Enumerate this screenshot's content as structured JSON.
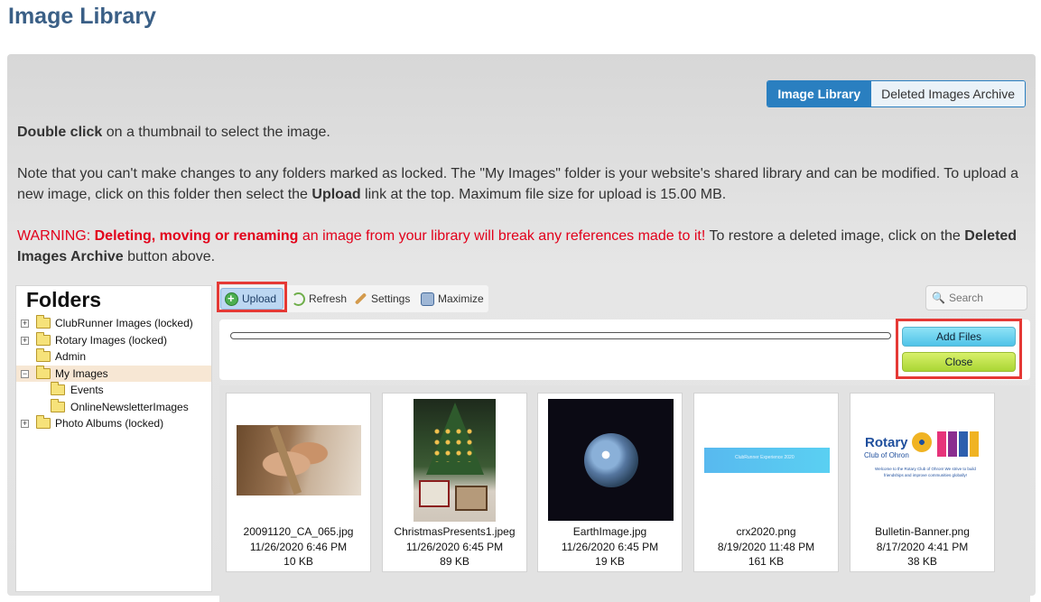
{
  "page": {
    "title": "Image Library"
  },
  "tabs": [
    {
      "label": "Image Library",
      "active": true
    },
    {
      "label": "Deleted Images Archive",
      "active": false
    }
  ],
  "instructions": {
    "line1_bold": "Double click",
    "line1_rest": " on a thumbnail to select the image.",
    "line2_part1": "Note that you can't make changes to any folders marked as locked. The \"My Images\" folder is your website's shared library and can be modified. To upload a new image, click on this folder then select the ",
    "line2_bold": "Upload",
    "line2_part2": " link at the top. Maximum file size for upload is 15.00 MB.",
    "warning_prefix": "WARNING: ",
    "warning_bold": "Deleting, moving or renaming",
    "warning_red_rest": " an image from your library will break any references made to it!",
    "warning_tail": " To restore a deleted image, click on the ",
    "warning_tail_bold": "Deleted Images Archive",
    "warning_tail_end": " button above."
  },
  "folders": {
    "title": "Folders",
    "items": [
      {
        "label": "ClubRunner Images (locked)",
        "expander": "+"
      },
      {
        "label": "Rotary Images (locked)",
        "expander": "+"
      },
      {
        "label": "Admin",
        "expander": ""
      },
      {
        "label": "My Images",
        "expander": "−",
        "selected": true
      },
      {
        "label": "Events",
        "expander": ""
      },
      {
        "label": "OnlineNewsletterImages",
        "expander": ""
      },
      {
        "label": "Photo Albums (locked)",
        "expander": "+"
      }
    ]
  },
  "toolbar": {
    "upload": "Upload",
    "refresh": "Refresh",
    "settings": "Settings",
    "maximize": "Maximize"
  },
  "search": {
    "placeholder": "Search"
  },
  "upload_panel": {
    "add_files": "Add Files",
    "close": "Close"
  },
  "thumbnails": [
    {
      "name": "20091120_CA_065.jpg",
      "date": "11/26/2020 6:46 PM",
      "size": "10 KB"
    },
    {
      "name": "ChristmasPresents1.jpeg",
      "date": "11/26/2020 6:45 PM",
      "size": "89 KB"
    },
    {
      "name": "EarthImage.jpg",
      "date": "11/26/2020 6:45 PM",
      "size": "19 KB"
    },
    {
      "name": "crx2020.png",
      "date": "8/19/2020 11:48 PM",
      "size": "161 KB"
    },
    {
      "name": "Bulletin-Banner.png",
      "date": "8/17/2020 4:41 PM",
      "size": "38 KB"
    }
  ],
  "banner_text": {
    "rotary_word": "Rotary",
    "rotary_sub": "Club of Ohron",
    "rotary_welcome": "Welcome to the Rotary Club of Ohron! We strive to build friendships and improve communities globally!",
    "crx_caption": "ClubRunner Experience 2020"
  },
  "colors": {
    "title": "#3a5f86",
    "accent_blue": "#2a7fc0",
    "warning_red": "#e2001a",
    "highlight_outline": "#e53935",
    "add_files": "#4fc3e8",
    "close": "#aad634",
    "selected_folder": "#f7e7d4"
  },
  "icons": {
    "upload": "plus-circle-icon",
    "refresh": "refresh-icon",
    "settings": "wrench-icon",
    "maximize": "maximize-icon",
    "search": "search-icon",
    "folder": "folder-icon"
  }
}
